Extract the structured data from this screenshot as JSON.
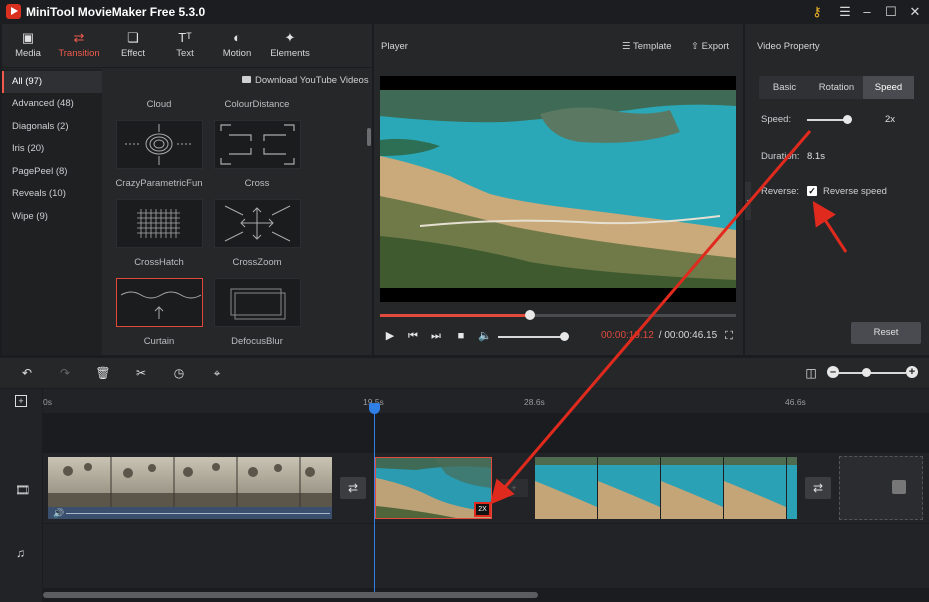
{
  "window": {
    "title": "MiniTool MovieMaker Free 5.3.0"
  },
  "toolbar": {
    "items": [
      {
        "label": "Media",
        "icon": "media-icon"
      },
      {
        "label": "Transition",
        "icon": "transition-icon",
        "active": true
      },
      {
        "label": "Effect",
        "icon": "effect-icon"
      },
      {
        "label": "Text",
        "icon": "text-icon"
      },
      {
        "label": "Motion",
        "icon": "motion-icon"
      },
      {
        "label": "Elements",
        "icon": "elements-icon"
      }
    ]
  },
  "categories": [
    {
      "label": "All (97)",
      "active": true
    },
    {
      "label": "Advanced (48)"
    },
    {
      "label": "Diagonals (2)"
    },
    {
      "label": "Iris (20)"
    },
    {
      "label": "PagePeel (8)"
    },
    {
      "label": "Reveals (10)"
    },
    {
      "label": "Wipe (9)"
    }
  ],
  "library": {
    "download_label": "Download YouTube Videos",
    "transitions": [
      "Cloud",
      "ColourDistance",
      "CrazyParametricFun",
      "Cross",
      "CrossHatch",
      "CrossZoom",
      "Curtain",
      "DefocusBlur"
    ]
  },
  "player": {
    "title": "Player",
    "template_label": "Template",
    "export_label": "Export",
    "time_current": "00:00:19.12",
    "time_separator": " / ",
    "time_total": "00:00:46.15",
    "progress": 0.42,
    "volume": 0.95
  },
  "property": {
    "title": "Video Property",
    "tabs": [
      {
        "label": "Basic"
      },
      {
        "label": "Rotation"
      },
      {
        "label": "Speed",
        "active": true
      }
    ],
    "speed_label": "Speed:",
    "speed_value": "2x",
    "duration_label": "Duration:",
    "duration_value": "8.1s",
    "reverse_label": "Reverse:",
    "reverse_text": "Reverse speed",
    "reverse_checked": true,
    "reset_label": "Reset"
  },
  "timeline": {
    "ruler": [
      "0s",
      "19.5s",
      "28.6s",
      "46.6s"
    ],
    "clip_badge": "2X"
  },
  "colors": {
    "accent": "#ef5a4b",
    "playhead": "#2f7fe6",
    "annotation": "#e02a1e"
  }
}
